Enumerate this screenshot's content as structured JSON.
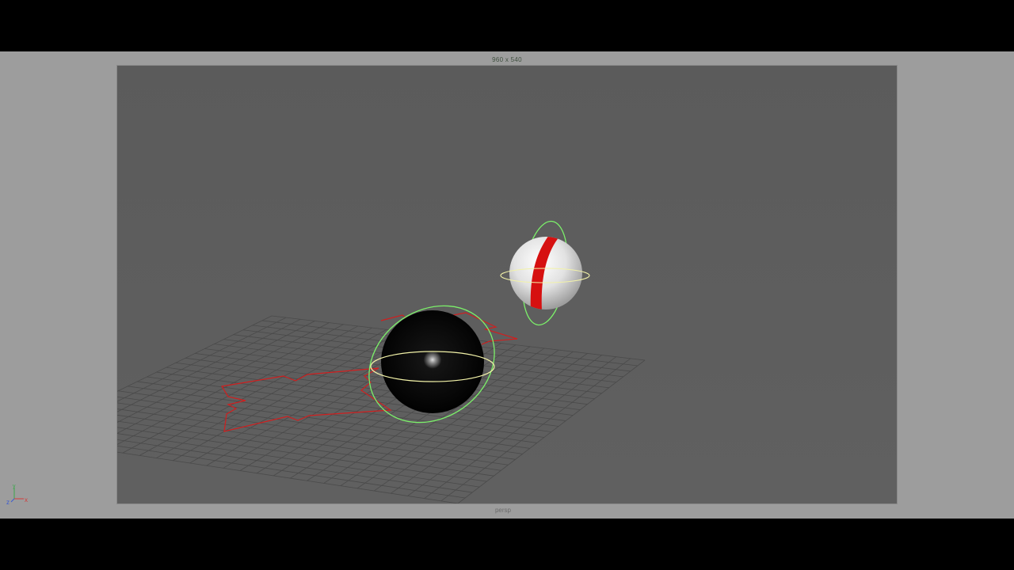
{
  "viewport": {
    "resolution_gate_label": "960 x 540",
    "camera_name": "persp"
  },
  "axis_gizmo": {
    "labels": {
      "x": "x",
      "y": "y",
      "z": "z"
    },
    "colors": {
      "x": "#d23a3a",
      "y": "#3aa84a",
      "z": "#3a5ad2"
    }
  },
  "scene": {
    "colors": {
      "grid_line": "#4a4a4a",
      "curve_outline": "#d01f1f",
      "rotate_ring_green": "#7cf06a",
      "rotate_ring_yellow": "#f2f2a8",
      "black_sphere": "#050505",
      "white_sphere": "#e8e8e8",
      "white_sphere_stripe": "#d61010"
    },
    "objects": [
      {
        "name": "ground-grid",
        "type": "grid"
      },
      {
        "name": "curve-outline",
        "type": "nurbs-curve"
      },
      {
        "name": "black-sphere",
        "type": "sphere",
        "selected": true
      },
      {
        "name": "striped-sphere",
        "type": "sphere",
        "selected": true
      }
    ]
  }
}
